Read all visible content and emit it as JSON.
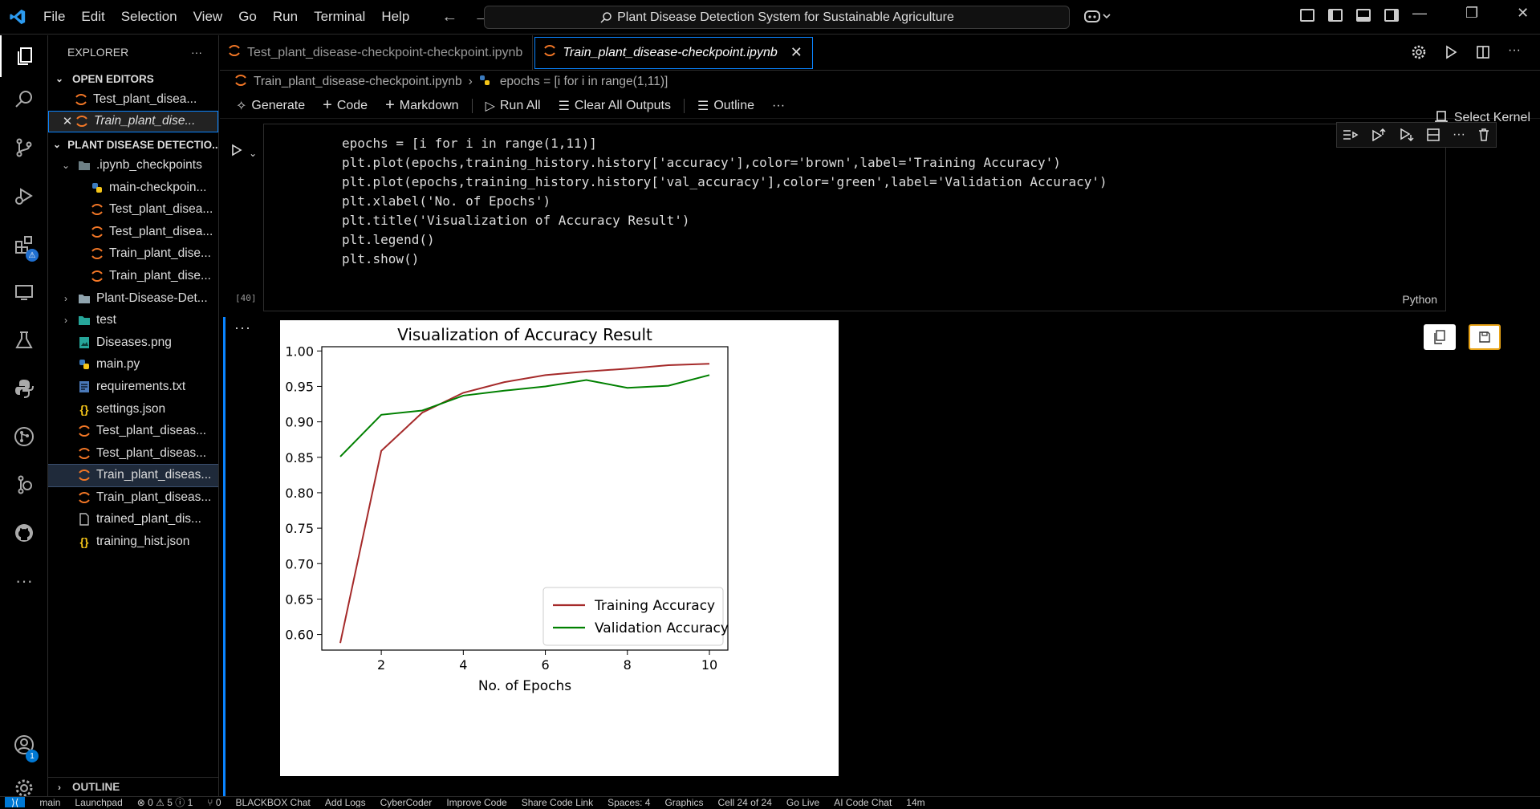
{
  "window": {
    "menu": [
      "File",
      "Edit",
      "Selection",
      "View",
      "Go",
      "Run",
      "Terminal",
      "Help"
    ],
    "search_text": "Plant Disease Detection System for Sustainable Agriculture"
  },
  "sidebar": {
    "title": "EXPLORER",
    "more": "···",
    "open_editors_label": "OPEN EDITORS",
    "open_editors": [
      {
        "label": "Test_plant_disea..."
      },
      {
        "label": "Train_plant_dise..."
      }
    ],
    "project_label": "PLANT DISEASE DETECTIO...",
    "files": [
      {
        "label": ".ipynb_checkpoints",
        "icon": "folder-config-icon",
        "indent": 1,
        "twistie": "⌄"
      },
      {
        "label": "main-checkpoin...",
        "icon": "python-file-icon",
        "indent": 2
      },
      {
        "label": "Test_plant_disea...",
        "icon": "jupyter-icon",
        "indent": 2
      },
      {
        "label": "Test_plant_disea...",
        "icon": "jupyter-icon",
        "indent": 2
      },
      {
        "label": "Train_plant_dise...",
        "icon": "jupyter-icon",
        "indent": 2
      },
      {
        "label": "Train_plant_dise...",
        "icon": "jupyter-icon",
        "indent": 2
      },
      {
        "label": "Plant-Disease-Det...",
        "icon": "folder-icon",
        "indent": 1,
        "twistie": "›"
      },
      {
        "label": "test",
        "icon": "folder-test-icon",
        "indent": 1,
        "twistie": "›"
      },
      {
        "label": "Diseases.png",
        "icon": "image-file-icon",
        "indent": 1
      },
      {
        "label": "main.py",
        "icon": "python-file-icon",
        "indent": 1
      },
      {
        "label": "requirements.txt",
        "icon": "text-file-icon",
        "indent": 1
      },
      {
        "label": "settings.json",
        "icon": "json-file-icon",
        "indent": 1
      },
      {
        "label": "Test_plant_diseas...",
        "icon": "jupyter-icon",
        "indent": 1
      },
      {
        "label": "Test_plant_diseas...",
        "icon": "jupyter-icon",
        "indent": 1
      },
      {
        "label": "Train_plant_diseas...",
        "icon": "jupyter-icon",
        "indent": 1,
        "selected": true
      },
      {
        "label": "Train_plant_diseas...",
        "icon": "jupyter-icon",
        "indent": 1
      },
      {
        "label": "trained_plant_dis...",
        "icon": "file-icon",
        "indent": 1
      },
      {
        "label": "training_hist.json",
        "icon": "json-file-icon",
        "indent": 1
      }
    ],
    "outline_label": "OUTLINE"
  },
  "editor": {
    "tabs": [
      {
        "label": "Test_plant_disease-checkpoint-checkpoint.ipynb",
        "active": false
      },
      {
        "label": "Train_plant_disease-checkpoint.ipynb",
        "active": true
      }
    ],
    "breadcrumb": {
      "file": "Train_plant_disease-checkpoint.ipynb",
      "symbol": "epochs = [i for i in range(1,11)]"
    },
    "toolbar": {
      "generate": "Generate",
      "code": "Code",
      "markdown": "Markdown",
      "run_all": "Run All",
      "clear_outputs": "Clear All Outputs",
      "outline": "Outline",
      "more": "···",
      "select_kernel": "Select Kernel"
    },
    "cell": {
      "exec_count": "[40]",
      "language": "Python",
      "output_more": "···",
      "code_lines": [
        "epochs = [i for i in range(1,11)]",
        "plt.plot(epochs,training_history.history['accuracy'],color='brown',label='Training Accuracy')",
        "plt.plot(epochs,training_history.history['val_accuracy'],color='green',label='Validation Accuracy')",
        "plt.xlabel('No. of Epochs')",
        "plt.title('Visualization of Accuracy Result')",
        "plt.legend()",
        "plt.show()"
      ]
    }
  },
  "chart_data": {
    "type": "line",
    "title": "Visualization of Accuracy Result",
    "xlabel": "No. of Epochs",
    "ylabel": "",
    "x": [
      1,
      2,
      3,
      4,
      5,
      6,
      7,
      8,
      9,
      10
    ],
    "xticks": [
      2,
      4,
      6,
      8,
      10
    ],
    "yticks": [
      0.6,
      0.65,
      0.7,
      0.75,
      0.8,
      0.85,
      0.9,
      0.95,
      1.0
    ],
    "xlim": [
      0.55,
      10.45
    ],
    "ylim": [
      0.578,
      1.006
    ],
    "legend": "lower right",
    "grid": false,
    "series": [
      {
        "name": "Training Accuracy",
        "color": "#a52a2a",
        "values": [
          0.588,
          0.859,
          0.913,
          0.941,
          0.956,
          0.966,
          0.971,
          0.975,
          0.98,
          0.982
        ]
      },
      {
        "name": "Validation Accuracy",
        "color": "#008000",
        "values": [
          0.851,
          0.91,
          0.916,
          0.937,
          0.944,
          0.95,
          0.959,
          0.948,
          0.951,
          0.966
        ]
      }
    ]
  },
  "statusbar": [
    "main",
    "Launchpad",
    "⊗ 0 ⚠ 5 ⓘ 1",
    "⑂ 0",
    "BLACKBOX Chat",
    "Add Logs",
    "CyberCoder",
    "Improve Code",
    "Share Code Link",
    "Spaces: 4",
    "Graphics",
    "Cell 24 of 24",
    "Go Live",
    "AI Code Chat",
    "14m"
  ]
}
